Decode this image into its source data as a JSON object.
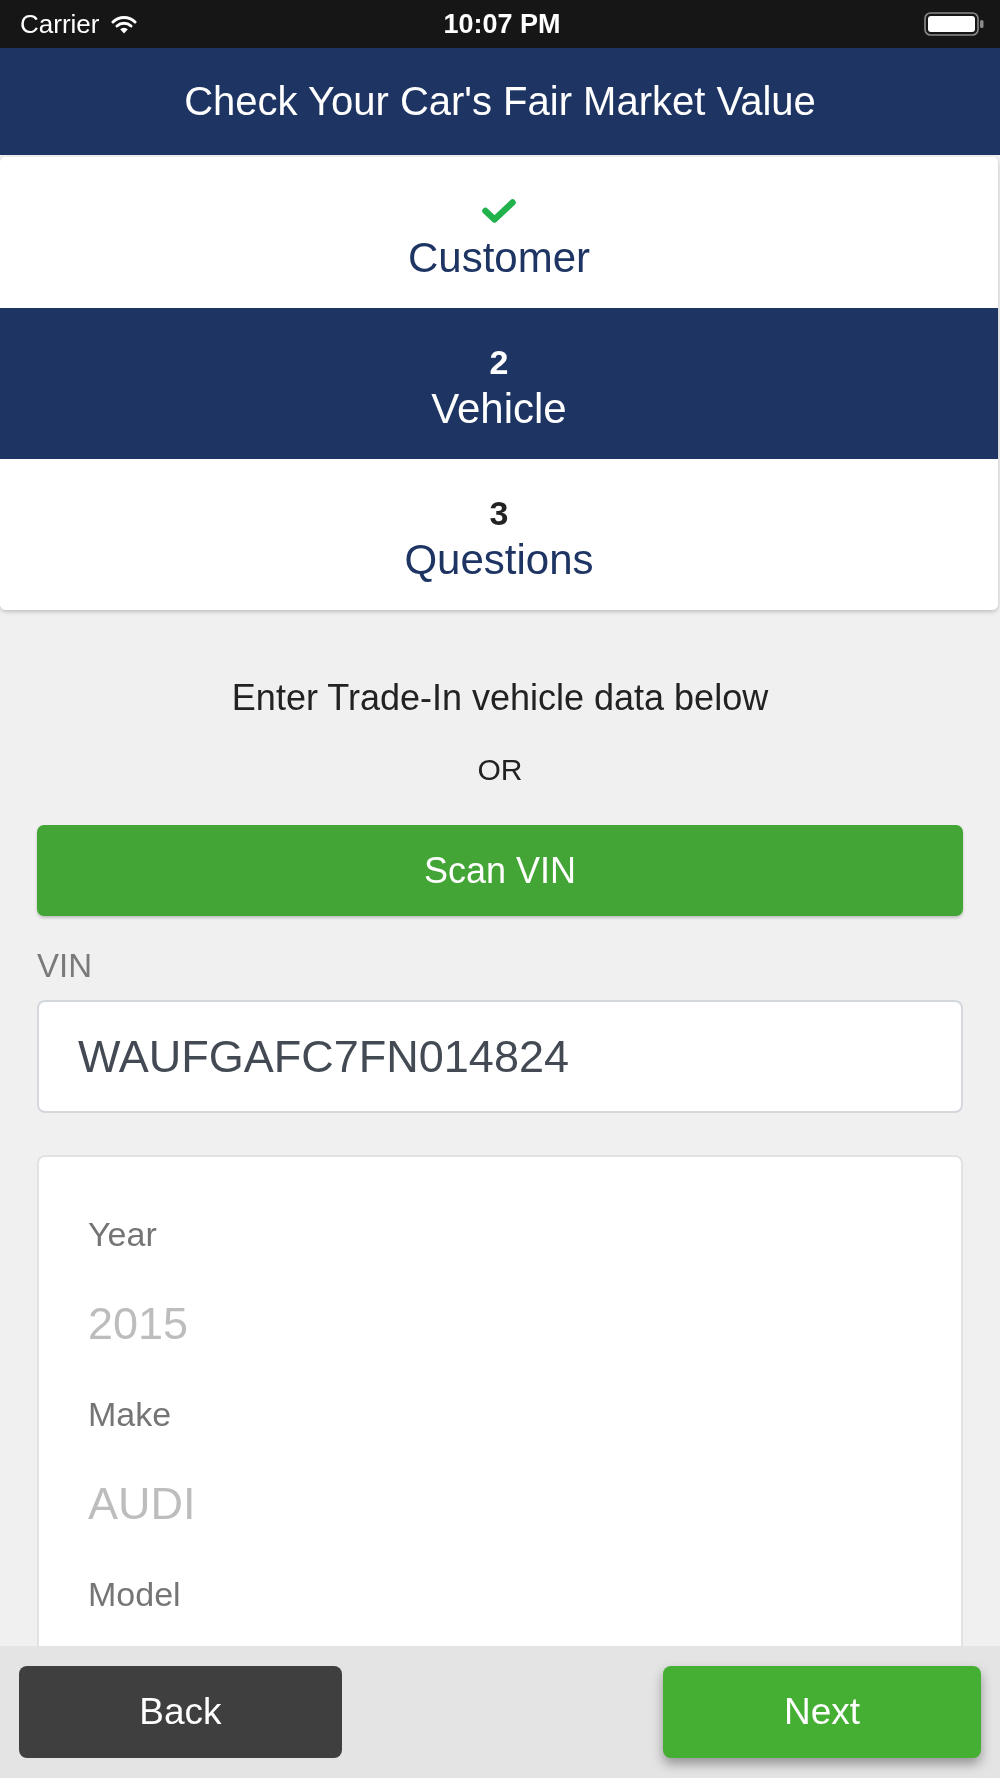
{
  "status_bar": {
    "carrier": "Carrier",
    "time": "10:07 PM"
  },
  "header": {
    "title": "Check Your Car's Fair Market Value"
  },
  "steps": [
    {
      "label": "Customer",
      "completed": true,
      "selected": false
    },
    {
      "number": "2",
      "label": "Vehicle",
      "completed": false,
      "selected": true
    },
    {
      "number": "3",
      "label": "Questions",
      "completed": false,
      "selected": false
    }
  ],
  "intro": {
    "text": "Enter Trade-In vehicle data below",
    "separator": "OR"
  },
  "scan_button": {
    "label": "Scan VIN"
  },
  "vin": {
    "label": "VIN",
    "value": "WAUFGAFC7FN014824"
  },
  "vehicle_fields": [
    {
      "label": "Year",
      "placeholder": "2015"
    },
    {
      "label": "Make",
      "placeholder": "AUDI"
    },
    {
      "label": "Model"
    }
  ],
  "footer": {
    "buttons": [
      {
        "kind": "back",
        "label": "Back"
      },
      {
        "kind": "next",
        "label": "Next"
      }
    ]
  }
}
